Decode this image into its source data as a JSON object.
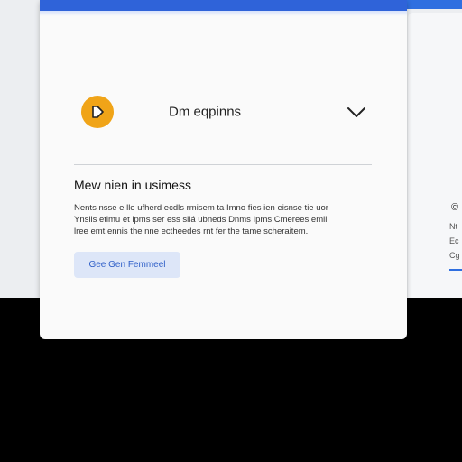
{
  "panel": {
    "header_title": "Dm eqpinns",
    "section_title": "Mew nien in usimess",
    "body_lines": [
      "Nents nsse e lle ufherd ecdls rmisem ta Imno fies ien eisnse tie uor",
      "Ynslis etimu et lpms ser ess sliá ubneds Dnms Ipms Cmerees emil",
      "lree emt ennis the nne ectheedes rnt fer the tame scheraitem."
    ],
    "cta_label": "Gee Gen Femmeel"
  },
  "side_card": {
    "icon_glyph": "©",
    "lines": [
      "Nt",
      "Ec",
      "Cg"
    ]
  },
  "colors": {
    "accent": "#2f63d9",
    "brand_icon": "#f0a418",
    "cta_bg": "#dde6f8",
    "cta_text": "#2f5fc8"
  },
  "icons": {
    "brand": "play-badge-icon",
    "expand": "chevron-down-icon"
  }
}
